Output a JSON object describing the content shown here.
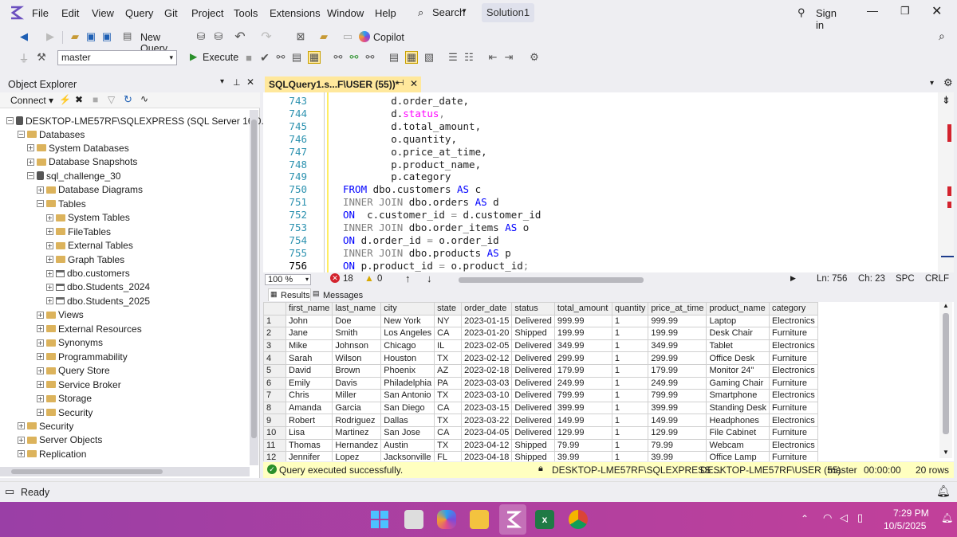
{
  "menu": [
    "File",
    "Edit",
    "View",
    "Query",
    "Git",
    "Project",
    "Tools",
    "Extensions",
    "Window",
    "Help"
  ],
  "search_label": "Search",
  "solution_label": "Solution1",
  "sign_in_label": "Sign in",
  "toolbar": {
    "new_query": "New Query",
    "copilot": "Copilot",
    "database": "master",
    "execute": "Execute"
  },
  "object_explorer": {
    "title": "Object Explorer",
    "connect": "Connect",
    "server": "DESKTOP-LME57RF\\SQLEXPRESS (SQL Server 16.0.100C",
    "tree": [
      {
        "label": "Databases",
        "sign": "⊟",
        "indent": 1,
        "icon": "folder"
      },
      {
        "label": "System Databases",
        "sign": "⊞",
        "indent": 2,
        "icon": "folder"
      },
      {
        "label": "Database Snapshots",
        "sign": "⊞",
        "indent": 2,
        "icon": "folder"
      },
      {
        "label": "sql_challenge_30",
        "sign": "⊟",
        "indent": 2,
        "icon": "database"
      },
      {
        "label": "Database Diagrams",
        "sign": "⊞",
        "indent": 3,
        "icon": "folder"
      },
      {
        "label": "Tables",
        "sign": "⊟",
        "indent": 3,
        "icon": "folder"
      },
      {
        "label": "System Tables",
        "sign": "⊞",
        "indent": 4,
        "icon": "folder"
      },
      {
        "label": "FileTables",
        "sign": "⊞",
        "indent": 4,
        "icon": "folder"
      },
      {
        "label": "External Tables",
        "sign": "⊞",
        "indent": 4,
        "icon": "folder"
      },
      {
        "label": "Graph Tables",
        "sign": "⊞",
        "indent": 4,
        "icon": "folder"
      },
      {
        "label": "dbo.customers",
        "sign": "⊞",
        "indent": 4,
        "icon": "table"
      },
      {
        "label": "dbo.Students_2024",
        "sign": "⊞",
        "indent": 4,
        "icon": "table"
      },
      {
        "label": "dbo.Students_2025",
        "sign": "⊞",
        "indent": 4,
        "icon": "table"
      },
      {
        "label": "Views",
        "sign": "⊞",
        "indent": 3,
        "icon": "folder"
      },
      {
        "label": "External Resources",
        "sign": "⊞",
        "indent": 3,
        "icon": "folder"
      },
      {
        "label": "Synonyms",
        "sign": "⊞",
        "indent": 3,
        "icon": "folder"
      },
      {
        "label": "Programmability",
        "sign": "⊞",
        "indent": 3,
        "icon": "folder"
      },
      {
        "label": "Query Store",
        "sign": "⊞",
        "indent": 3,
        "icon": "folder"
      },
      {
        "label": "Service Broker",
        "sign": "⊞",
        "indent": 3,
        "icon": "folder"
      },
      {
        "label": "Storage",
        "sign": "⊞",
        "indent": 3,
        "icon": "folder"
      },
      {
        "label": "Security",
        "sign": "⊞",
        "indent": 3,
        "icon": "folder"
      },
      {
        "label": "Security",
        "sign": "⊞",
        "indent": 1,
        "icon": "folder"
      },
      {
        "label": "Server Objects",
        "sign": "⊞",
        "indent": 1,
        "icon": "folder"
      },
      {
        "label": "Replication",
        "sign": "⊞",
        "indent": 1,
        "icon": "folder"
      }
    ]
  },
  "editor": {
    "tab_title": "SQLQuery1.s...F\\USER (55))*",
    "lines": [
      {
        "n": "743",
        "code": [
          [
            "",
            "        d.order_date,"
          ]
        ]
      },
      {
        "n": "744",
        "code": [
          [
            "",
            "        d."
          ],
          [
            "fn",
            "status"
          ],
          [
            "gr",
            ","
          ]
        ]
      },
      {
        "n": "745",
        "code": [
          [
            "",
            "        d.total_amount,"
          ]
        ]
      },
      {
        "n": "746",
        "code": [
          [
            "",
            "        o.quantity,"
          ]
        ]
      },
      {
        "n": "747",
        "code": [
          [
            "",
            "        o.price_at_time,"
          ]
        ]
      },
      {
        "n": "748",
        "code": [
          [
            "",
            "        p.product_name,"
          ]
        ]
      },
      {
        "n": "749",
        "code": [
          [
            "",
            "        p.category"
          ]
        ]
      },
      {
        "n": "750",
        "code": [
          [
            "kw",
            "FROM"
          ],
          [
            "",
            " dbo.customers "
          ],
          [
            "kw",
            "AS"
          ],
          [
            "",
            " c"
          ]
        ]
      },
      {
        "n": "751",
        "code": [
          [
            "gr",
            "INNER JOIN"
          ],
          [
            "",
            " dbo.orders "
          ],
          [
            "kw",
            "AS"
          ],
          [
            "",
            " d"
          ]
        ]
      },
      {
        "n": "752",
        "code": [
          [
            "kw",
            "ON"
          ],
          [
            "",
            "  c.customer_id "
          ],
          [
            "gr",
            "="
          ],
          [
            "",
            " d.customer_id"
          ]
        ]
      },
      {
        "n": "753",
        "code": [
          [
            "gr",
            "INNER JOIN"
          ],
          [
            "",
            " dbo.order_items "
          ],
          [
            "kw",
            "AS"
          ],
          [
            "",
            " o"
          ]
        ]
      },
      {
        "n": "754",
        "code": [
          [
            "kw",
            "ON"
          ],
          [
            "",
            " d.order_id "
          ],
          [
            "gr",
            "="
          ],
          [
            "",
            " o.order_id"
          ]
        ]
      },
      {
        "n": "755",
        "code": [
          [
            "gr",
            "INNER JOIN"
          ],
          [
            "",
            " dbo.products "
          ],
          [
            "kw",
            "AS"
          ],
          [
            "",
            " p"
          ]
        ]
      },
      {
        "n": "756",
        "code": [
          [
            "kw",
            "ON"
          ],
          [
            "",
            " p.product_id "
          ],
          [
            "gr",
            "="
          ],
          [
            "",
            " o.product_id"
          ],
          [
            "gr",
            ";"
          ]
        ]
      }
    ],
    "zoom": "100 %",
    "errors": "18",
    "warnings": "0",
    "ln": "Ln: 756",
    "ch": "Ch: 23",
    "spc": "SPC",
    "crlf": "CRLF"
  },
  "results_tabs": {
    "results": "Results",
    "messages": "Messages"
  },
  "results": {
    "columns": [
      "first_name",
      "last_name",
      "city",
      "state",
      "order_date",
      "status",
      "total_amount",
      "quantity",
      "price_at_time",
      "product_name",
      "category"
    ],
    "rows": [
      [
        "1",
        "John",
        "Doe",
        "New York",
        "NY",
        "2023-01-15",
        "Delivered",
        "999.99",
        "1",
        "999.99",
        "Laptop",
        "Electronics"
      ],
      [
        "2",
        "Jane",
        "Smith",
        "Los Angeles",
        "CA",
        "2023-01-20",
        "Shipped",
        "199.99",
        "1",
        "199.99",
        "Desk Chair",
        "Furniture"
      ],
      [
        "3",
        "Mike",
        "Johnson",
        "Chicago",
        "IL",
        "2023-02-05",
        "Delivered",
        "349.99",
        "1",
        "349.99",
        "Tablet",
        "Electronics"
      ],
      [
        "4",
        "Sarah",
        "Wilson",
        "Houston",
        "TX",
        "2023-02-12",
        "Delivered",
        "299.99",
        "1",
        "299.99",
        "Office Desk",
        "Furniture"
      ],
      [
        "5",
        "David",
        "Brown",
        "Phoenix",
        "AZ",
        "2023-02-18",
        "Delivered",
        "179.99",
        "1",
        "179.99",
        "Monitor 24\"",
        "Electronics"
      ],
      [
        "6",
        "Emily",
        "Davis",
        "Philadelphia",
        "PA",
        "2023-03-03",
        "Delivered",
        "249.99",
        "1",
        "249.99",
        "Gaming Chair",
        "Furniture"
      ],
      [
        "7",
        "Chris",
        "Miller",
        "San Antonio",
        "TX",
        "2023-03-10",
        "Delivered",
        "799.99",
        "1",
        "799.99",
        "Smartphone",
        "Electronics"
      ],
      [
        "8",
        "Amanda",
        "Garcia",
        "San Diego",
        "CA",
        "2023-03-15",
        "Delivered",
        "399.99",
        "1",
        "399.99",
        "Standing Desk",
        "Furniture"
      ],
      [
        "9",
        "Robert",
        "Rodriguez",
        "Dallas",
        "TX",
        "2023-03-22",
        "Delivered",
        "149.99",
        "1",
        "149.99",
        "Headphones",
        "Electronics"
      ],
      [
        "10",
        "Lisa",
        "Martinez",
        "San Jose",
        "CA",
        "2023-04-05",
        "Delivered",
        "129.99",
        "1",
        "129.99",
        "File Cabinet",
        "Furniture"
      ],
      [
        "11",
        "Thomas",
        "Hernandez",
        "Austin",
        "TX",
        "2023-04-12",
        "Shipped",
        "79.99",
        "1",
        "79.99",
        "Webcam",
        "Electronics"
      ],
      [
        "12",
        "Jennifer",
        "Lopez",
        "Jacksonville",
        "FL",
        "2023-04-18",
        "Shipped",
        "39.99",
        "1",
        "39.99",
        "Office Lamp",
        "Furniture"
      ]
    ]
  },
  "query_status": {
    "message": "Query executed successfully.",
    "server": "DESKTOP-LME57RF\\SQLEXPRESS ...",
    "user": "DESKTOP-LME57RF\\USER (55)",
    "db": "master",
    "time": "00:00:00",
    "rows": "20 rows"
  },
  "statusbar": {
    "ready": "Ready"
  },
  "clock": {
    "time": "7:29 PM",
    "date": "10/5/2025"
  }
}
